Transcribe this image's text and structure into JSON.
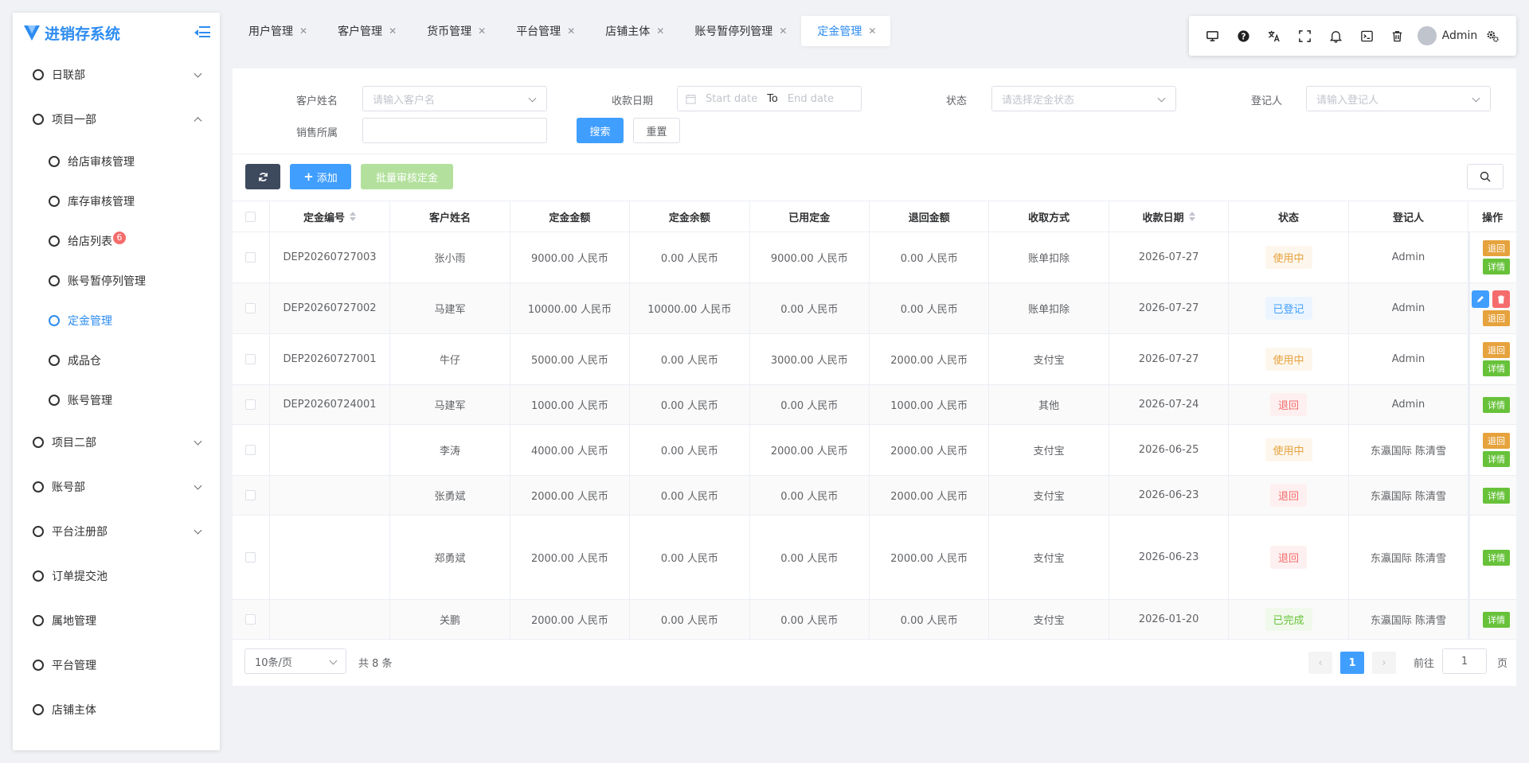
{
  "app": {
    "title": "进销存系统",
    "brand_color": "#2d8cf0"
  },
  "sidebar": {
    "items": [
      {
        "label": "日联部",
        "expandable": true,
        "expanded": false
      },
      {
        "label": "项目一部",
        "expandable": true,
        "expanded": true
      },
      {
        "label": "给店审核管理",
        "sub": true
      },
      {
        "label": "库存审核管理",
        "sub": true
      },
      {
        "label": "给店列表",
        "sub": true,
        "badge": "6"
      },
      {
        "label": "账号暂停列管理",
        "sub": true
      },
      {
        "label": "定金管理",
        "sub": true,
        "active": true
      },
      {
        "label": "成品仓",
        "sub": true
      },
      {
        "label": "账号管理",
        "sub": true
      },
      {
        "label": "项目二部",
        "expandable": true,
        "expanded": false
      },
      {
        "label": "账号部",
        "expandable": true,
        "expanded": false
      },
      {
        "label": "平台注册部",
        "expandable": true,
        "expanded": false
      },
      {
        "label": "订单提交池"
      },
      {
        "label": "属地管理"
      },
      {
        "label": "平台管理"
      },
      {
        "label": "店铺主体"
      }
    ]
  },
  "tabs": [
    {
      "label": "用户管理"
    },
    {
      "label": "客户管理"
    },
    {
      "label": "货币管理"
    },
    {
      "label": "平台管理"
    },
    {
      "label": "店铺主体"
    },
    {
      "label": "账号暂停列管理"
    },
    {
      "label": "定金管理",
      "active": true
    }
  ],
  "toolbar": {
    "icons": [
      "monitor-icon",
      "help-icon",
      "translate-icon",
      "fullscreen-icon",
      "bell-icon",
      "terminal-icon",
      "trash-icon"
    ],
    "user": "Admin"
  },
  "filters": {
    "customer_label": "客户姓名",
    "customer_placeholder": "请输入客户名",
    "date_label": "收款日期",
    "date_start": "Start date",
    "date_to": "To",
    "date_end": "End date",
    "status_label": "状态",
    "status_placeholder": "请选择定金状态",
    "registrar_label": "登记人",
    "registrar_placeholder": "请输入登记人",
    "sales_label": "销售所属",
    "sales_value": "",
    "search_label": "搜索",
    "reset_label": "重置"
  },
  "actions": {
    "add_label": "添加",
    "batch_label": "批量审核定金"
  },
  "table": {
    "columns": [
      "定金编号",
      "客户姓名",
      "定金金额",
      "定金余额",
      "已用定金",
      "退回金额",
      "收取方式",
      "收款日期",
      "状态",
      "登记人",
      "操作"
    ],
    "rows": [
      {
        "id": "DEP20260727003",
        "customer": "张小雨",
        "amount": "9000.00 人民币",
        "balance": "0.00 人民币",
        "used": "9000.00 人民币",
        "refund": "0.00 人民币",
        "method": "账单扣除",
        "date": "2026-07-27",
        "status": "使用中",
        "status_color": "orange",
        "registrar": "Admin",
        "ops": [
          "退回",
          "详情"
        ]
      },
      {
        "id": "DEP20260727002",
        "customer": "马建军",
        "amount": "10000.00 人民币",
        "balance": "10000.00 人民币",
        "used": "0.00 人民币",
        "refund": "0.00 人民币",
        "method": "账单扣除",
        "date": "2026-07-27",
        "status": "已登记",
        "status_color": "blue",
        "registrar": "Admin",
        "ops": [
          "编辑",
          "删除",
          "退回"
        ]
      },
      {
        "id": "DEP20260727001",
        "customer": "牛仔",
        "amount": "5000.00 人民币",
        "balance": "0.00 人民币",
        "used": "3000.00 人民币",
        "refund": "2000.00 人民币",
        "method": "支付宝",
        "date": "2026-07-27",
        "status": "使用中",
        "status_color": "orange",
        "registrar": "Admin",
        "ops": [
          "退回",
          "详情"
        ]
      },
      {
        "id": "DEP20260724001",
        "customer": "马建军",
        "amount": "1000.00 人民币",
        "balance": "0.00 人民币",
        "used": "0.00 人民币",
        "refund": "1000.00 人民币",
        "method": "其他",
        "date": "2026-07-24",
        "status": "退回",
        "status_color": "red",
        "registrar": "Admin",
        "ops": [
          "详情"
        ]
      },
      {
        "id": "",
        "customer": "李涛",
        "amount": "4000.00 人民币",
        "balance": "0.00 人民币",
        "used": "2000.00 人民币",
        "refund": "2000.00 人民币",
        "method": "支付宝",
        "date": "2026-06-25",
        "status": "使用中",
        "status_color": "orange",
        "registrar": "东瀛国际 陈清雪",
        "ops": [
          "退回",
          "详情"
        ]
      },
      {
        "id": "",
        "customer": "张勇斌",
        "amount": "2000.00 人民币",
        "balance": "0.00 人民币",
        "used": "0.00 人民币",
        "refund": "2000.00 人民币",
        "method": "支付宝",
        "date": "2026-06-23",
        "status": "退回",
        "status_color": "red",
        "registrar": "东瀛国际 陈清雪",
        "ops": [
          "详情"
        ]
      },
      {
        "id": "",
        "customer": "郑勇斌",
        "amount": "2000.00 人民币",
        "balance": "0.00 人民币",
        "used": "0.00 人民币",
        "refund": "2000.00 人民币",
        "method": "支付宝",
        "date": "2026-06-23",
        "status": "退回",
        "status_color": "red",
        "registrar": "东瀛国际 陈清雪",
        "ops": [
          "详情"
        ]
      },
      {
        "id": "",
        "customer": "关鹏",
        "amount": "2000.00 人民币",
        "balance": "0.00 人民币",
        "used": "0.00 人民币",
        "refund": "0.00 人民币",
        "method": "支付宝",
        "date": "2026-01-20",
        "status": "已完成",
        "status_color": "green",
        "registrar": "东瀛国际 陈清雪",
        "ops": [
          "详情"
        ]
      }
    ]
  },
  "pagination": {
    "page_size": "10条/页",
    "total": "共 8 条",
    "current": "1",
    "goto_label": "前往",
    "goto_value": "1",
    "page_suffix": "页"
  }
}
